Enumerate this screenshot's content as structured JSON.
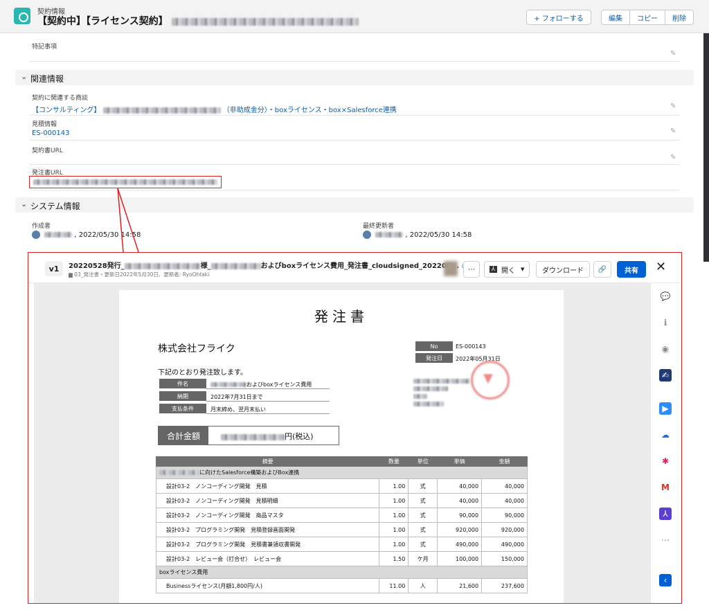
{
  "header": {
    "object_type": "契約情報",
    "title": "【契約中】【ライセンス契約】",
    "follow_label": "+ フォローする",
    "edit_label": "編集",
    "copy_label": "コピー",
    "delete_label": "削除"
  },
  "fields": {
    "special_notes_label": "特記事項",
    "related_section": "関連情報",
    "related_deal_label": "契約に関連する商談",
    "related_deal_prefix": "【コンサルティング】",
    "related_deal_suffix": "（非助成金分）・boxライセンス・box×Salesforce連携",
    "quote_label": "見積情報",
    "quote_value": "ES-000143",
    "contract_url_label": "契約書URL",
    "po_url_label": "発注書URL",
    "system_section": "システム情報",
    "created_by_label": "作成者",
    "created_by_date": ", 2022/05/30 14:58",
    "modified_by_label": "最終更新者",
    "modified_by_date": ", 2022/05/30 14:58"
  },
  "box": {
    "version": "v1",
    "file_name_prefix": "20220528発行_",
    "file_name_mid": "様_",
    "file_name_suffix": "およびboxライセンス費用_発注書_cloudsigned_202205...",
    "meta": "03_発注書・更新日2022年5月30日、更新者: RyoOhtaki",
    "open_label": "開く",
    "download_label": "ダウンロード",
    "share_label": "共有",
    "close_icon": "close-icon"
  },
  "document": {
    "title": "発注書",
    "company": "株式会社フライク",
    "no_label": "No",
    "no_value": "ES-000143",
    "order_date_label": "発注日",
    "order_date_value": "2022年05月31日",
    "intro": "下記のとおり発注致します。",
    "subject_label": "件名",
    "subject_value": "およびboxライセンス費用",
    "deadline_label": "納期",
    "deadline_value": "2022年7月31日まで",
    "payment_label": "支払条件",
    "payment_value": "月末締め、翌月末払い",
    "total_label": "合計金額",
    "total_suffix": "円(税込)",
    "table_headers": [
      "摘要",
      "数量",
      "単位",
      "単価",
      "金額"
    ],
    "group1": "に向けたSalesforce構築およびBox連携",
    "rows1": [
      {
        "desc": "設計03-2　ノンコーディング開発　見積",
        "qty": "1.00",
        "unit": "式",
        "price": "40,000",
        "amount": "40,000"
      },
      {
        "desc": "設計03-2　ノンコーディング開発　見積明細",
        "qty": "1.00",
        "unit": "式",
        "price": "40,000",
        "amount": "40,000"
      },
      {
        "desc": "設計03-2　ノンコーディング開発　商品マスタ",
        "qty": "1.00",
        "unit": "式",
        "price": "90,000",
        "amount": "90,000"
      },
      {
        "desc": "設計03-2　プログラミング開発　見積登録画面開発",
        "qty": "1.00",
        "unit": "式",
        "price": "920,000",
        "amount": "920,000"
      },
      {
        "desc": "設計03-2　プログラミング開発　見積書兼領収書開発",
        "qty": "1.00",
        "unit": "式",
        "price": "490,000",
        "amount": "490,000"
      },
      {
        "desc": "設計03-2　レビュー会（打合せ）　レビュー会",
        "qty": "1.50",
        "unit": "ケ月",
        "price": "100,000",
        "amount": "150,000"
      }
    ],
    "group2": "boxライセンス費用",
    "rows2": [
      {
        "desc": "Businessライセンス(月額1,800円/人)",
        "qty": "11.00",
        "unit": "人",
        "price": "21,600",
        "amount": "237,600"
      }
    ]
  },
  "colors": {
    "accent": "#0b5cab",
    "box_blue": "#0061d5",
    "highlight": "#e02020"
  }
}
